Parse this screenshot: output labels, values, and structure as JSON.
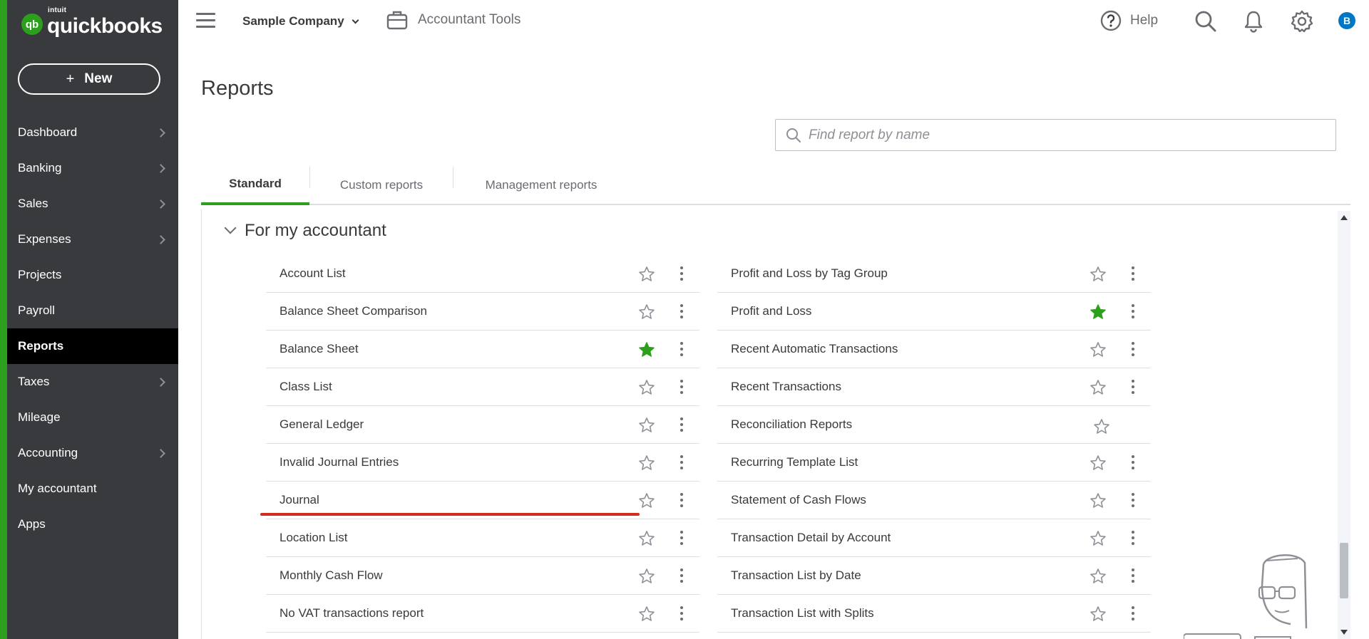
{
  "brand": {
    "logo_mark": "qb",
    "intuit": "intuit",
    "name": "quickbooks",
    "color": "#2ca01c"
  },
  "sidebar": {
    "new_button": {
      "icon": "plus",
      "label": "New"
    },
    "items": [
      {
        "label": "Dashboard",
        "chevron": true,
        "active": false
      },
      {
        "label": "Banking",
        "chevron": true,
        "active": false
      },
      {
        "label": "Sales",
        "chevron": true,
        "active": false
      },
      {
        "label": "Expenses",
        "chevron": true,
        "active": false
      },
      {
        "label": "Projects",
        "chevron": false,
        "active": false
      },
      {
        "label": "Payroll",
        "chevron": false,
        "active": false
      },
      {
        "label": "Reports",
        "chevron": false,
        "active": true
      },
      {
        "label": "Taxes",
        "chevron": true,
        "active": false
      },
      {
        "label": "Mileage",
        "chevron": false,
        "active": false
      },
      {
        "label": "Accounting",
        "chevron": true,
        "active": false
      },
      {
        "label": "My accountant",
        "chevron": false,
        "active": false
      },
      {
        "label": "Apps",
        "chevron": false,
        "active": false
      }
    ]
  },
  "topbar": {
    "company": "Sample Company",
    "accountant_tools": "Accountant Tools",
    "help": "Help",
    "avatar_initial": "B",
    "icons": [
      "menu-icon",
      "briefcase-icon",
      "help-circle-icon",
      "search-icon",
      "bell-icon",
      "gear-icon"
    ]
  },
  "page": {
    "title": "Reports",
    "search_placeholder": "Find report by name"
  },
  "tabs": [
    {
      "label": "Standard",
      "active": true
    },
    {
      "label": "Custom reports",
      "active": false
    },
    {
      "label": "Management reports",
      "active": false
    }
  ],
  "section": {
    "title": "For my accountant",
    "left_reports": [
      {
        "name": "Account List",
        "favorite": false
      },
      {
        "name": "Balance Sheet Comparison",
        "favorite": false
      },
      {
        "name": "Balance Sheet",
        "favorite": true
      },
      {
        "name": "Class List",
        "favorite": false
      },
      {
        "name": "General Ledger",
        "favorite": false
      },
      {
        "name": "Invalid Journal Entries",
        "favorite": false
      },
      {
        "name": "Journal",
        "favorite": false
      },
      {
        "name": "Location List",
        "favorite": false
      },
      {
        "name": "Monthly Cash Flow",
        "favorite": false
      },
      {
        "name": "No VAT transactions report",
        "favorite": false
      }
    ],
    "right_reports": [
      {
        "name": "Profit and Loss by Tag Group",
        "favorite": false,
        "menu": true
      },
      {
        "name": "Profit and Loss",
        "favorite": true,
        "menu": true
      },
      {
        "name": "Recent Automatic Transactions",
        "favorite": false,
        "menu": true
      },
      {
        "name": "Recent Transactions",
        "favorite": false,
        "menu": true
      },
      {
        "name": "Reconciliation Reports",
        "favorite": false,
        "menu": false
      },
      {
        "name": "Recurring Template List",
        "favorite": false,
        "menu": true
      },
      {
        "name": "Statement of Cash Flows",
        "favorite": false,
        "menu": true
      },
      {
        "name": "Transaction Detail by Account",
        "favorite": false,
        "menu": true
      },
      {
        "name": "Transaction List by Date",
        "favorite": false,
        "menu": true
      },
      {
        "name": "Transaction List with Splits",
        "favorite": false,
        "menu": true
      }
    ]
  },
  "colors": {
    "sidebar": "#393a3d",
    "active_nav": "#000000",
    "accent": "#2ca01c",
    "favorite_star": "#2ca01c",
    "annotation": "#d52b1e",
    "avatar": "#0077c5"
  }
}
